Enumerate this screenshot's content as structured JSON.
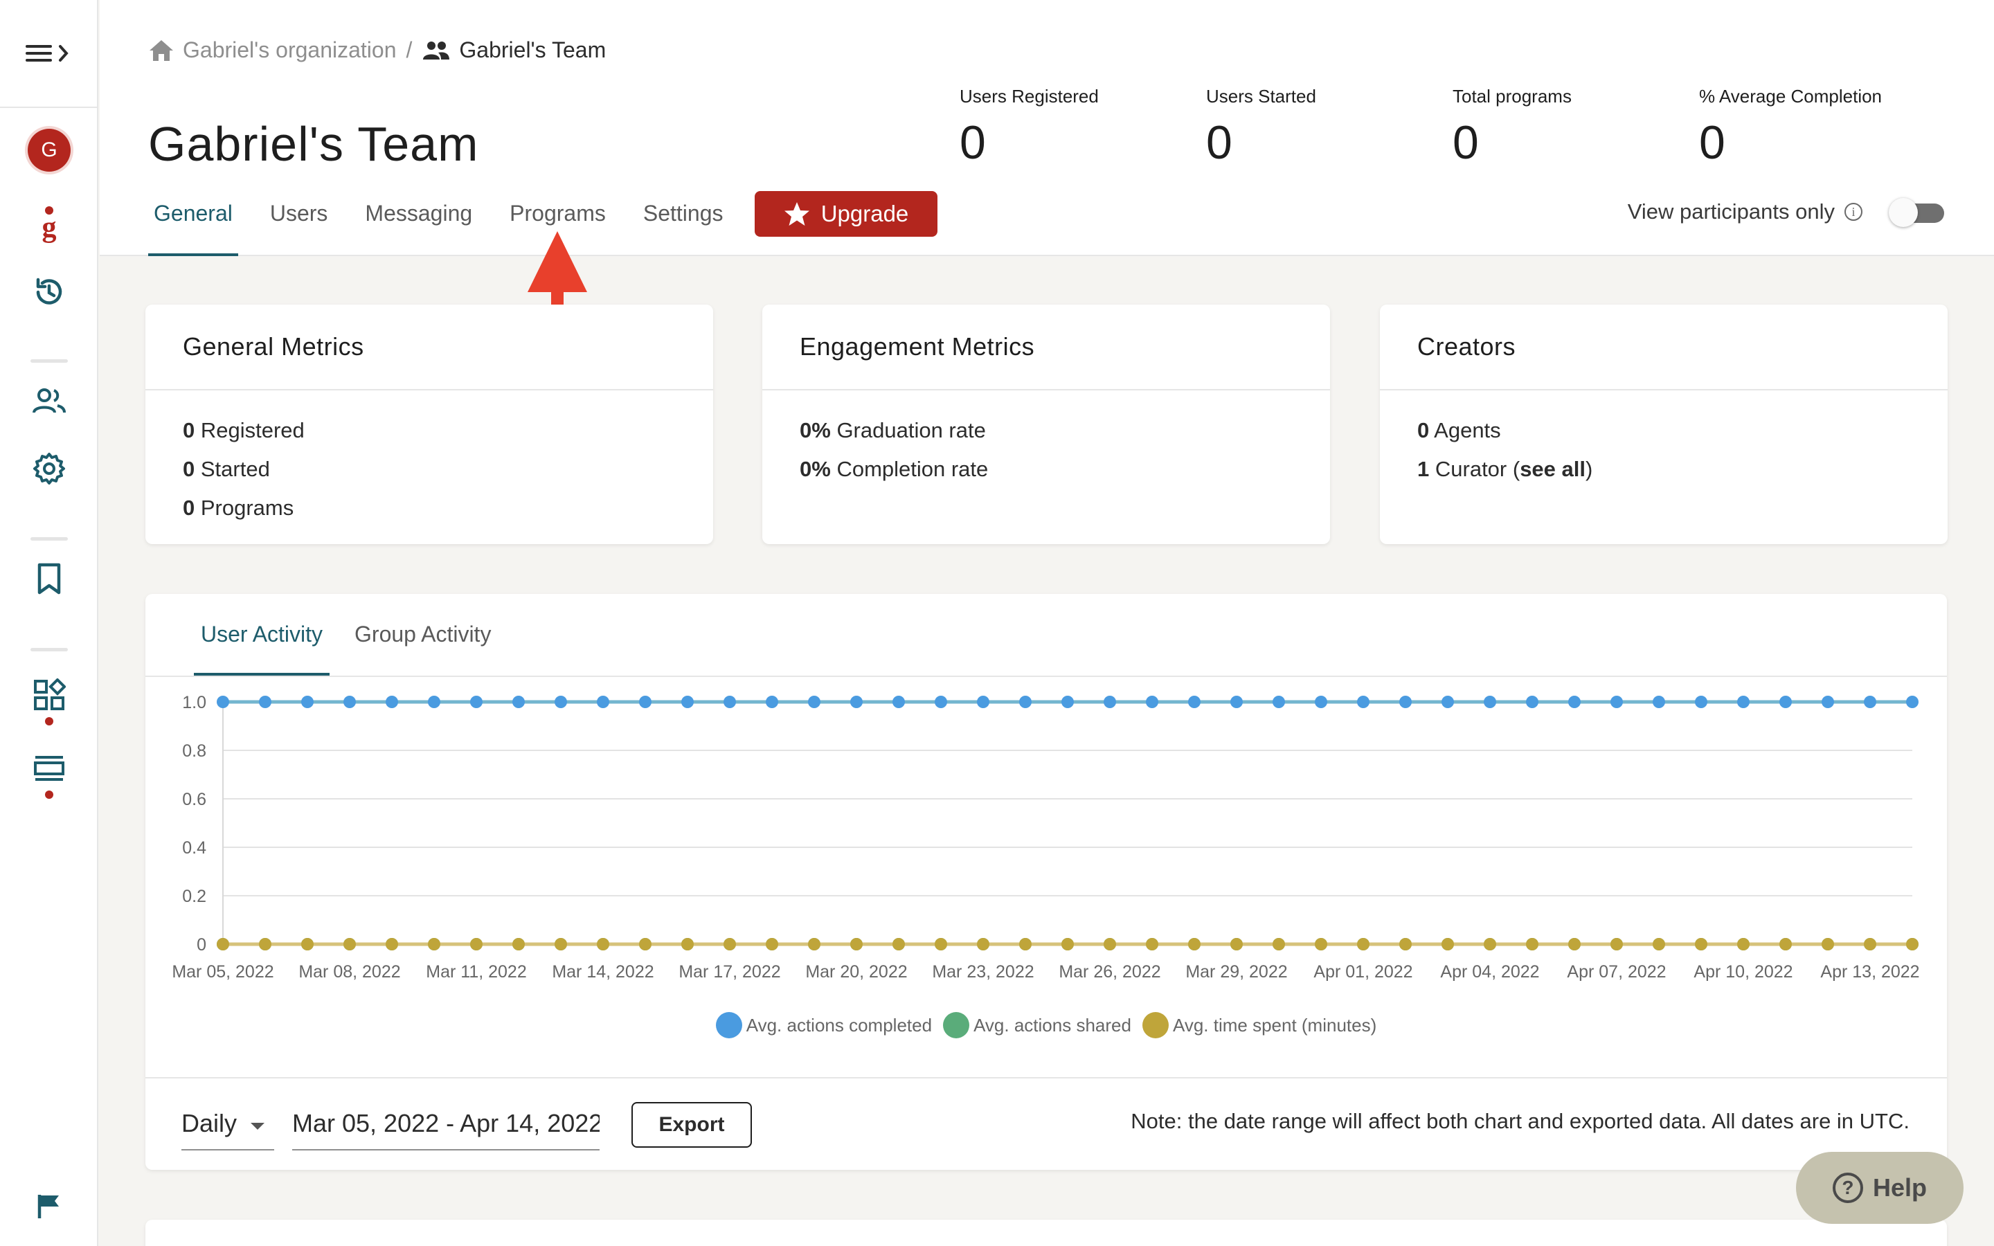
{
  "breadcrumb": {
    "org": "Gabriel's organization",
    "separator": "/",
    "team": "Gabriel's Team"
  },
  "page_title": "Gabriel's Team",
  "stats": [
    {
      "label": "Users Registered",
      "value": "0"
    },
    {
      "label": "Users Started",
      "value": "0"
    },
    {
      "label": "Total programs",
      "value": "0"
    },
    {
      "label": "% Average Completion",
      "value": "0"
    }
  ],
  "tabs": [
    {
      "label": "General",
      "active": true
    },
    {
      "label": "Users"
    },
    {
      "label": "Messaging"
    },
    {
      "label": "Programs"
    },
    {
      "label": "Settings"
    }
  ],
  "upgrade_label": "Upgrade",
  "view_participants_label": "View participants only",
  "avatar_initial": "G",
  "cards": {
    "general": {
      "title": "General Metrics",
      "rows": [
        {
          "value": "0",
          "label": "Registered"
        },
        {
          "value": "0",
          "label": "Started"
        },
        {
          "value": "0",
          "label": "Programs"
        }
      ]
    },
    "engagement": {
      "title": "Engagement Metrics",
      "rows": [
        {
          "value": "0%",
          "label": "Graduation rate"
        },
        {
          "value": "0%",
          "label": "Completion rate"
        }
      ]
    },
    "creators": {
      "title": "Creators",
      "rows": [
        {
          "value": "0",
          "label": "Agents"
        },
        {
          "value": "1",
          "label": "Curator (",
          "link": "see all",
          "suffix": ")"
        }
      ]
    }
  },
  "activity_tabs": [
    {
      "label": "User Activity",
      "active": true
    },
    {
      "label": "Group Activity"
    }
  ],
  "chart_data": {
    "type": "line",
    "x": [
      "Mar 05, 2022",
      "Mar 06, 2022",
      "Mar 07, 2022",
      "Mar 08, 2022",
      "Mar 09, 2022",
      "Mar 10, 2022",
      "Mar 11, 2022",
      "Mar 12, 2022",
      "Mar 13, 2022",
      "Mar 14, 2022",
      "Mar 15, 2022",
      "Mar 16, 2022",
      "Mar 17, 2022",
      "Mar 18, 2022",
      "Mar 19, 2022",
      "Mar 20, 2022",
      "Mar 21, 2022",
      "Mar 22, 2022",
      "Mar 23, 2022",
      "Mar 24, 2022",
      "Mar 25, 2022",
      "Mar 26, 2022",
      "Mar 27, 2022",
      "Mar 28, 2022",
      "Mar 29, 2022",
      "Mar 30, 2022",
      "Mar 31, 2022",
      "Apr 01, 2022",
      "Apr 02, 2022",
      "Apr 03, 2022",
      "Apr 04, 2022",
      "Apr 05, 2022",
      "Apr 06, 2022",
      "Apr 07, 2022",
      "Apr 08, 2022",
      "Apr 09, 2022",
      "Apr 10, 2022",
      "Apr 11, 2022",
      "Apr 12, 2022",
      "Apr 13, 2022",
      "Apr 14, 2022"
    ],
    "x_tick_labels": [
      "Mar 05, 2022",
      "Mar 08, 2022",
      "Mar 11, 2022",
      "Mar 14, 2022",
      "Mar 17, 2022",
      "Mar 20, 2022",
      "Mar 23, 2022",
      "Mar 26, 2022",
      "Mar 29, 2022",
      "Apr 01, 2022",
      "Apr 04, 2022",
      "Apr 07, 2022",
      "Apr 10, 2022",
      "Apr 13, 2022"
    ],
    "y_ticks": [
      "0",
      "0.2",
      "0.4",
      "0.6",
      "0.8",
      "1.0"
    ],
    "ylim": [
      0,
      1
    ],
    "grid": true,
    "legend_position": "bottom",
    "series": [
      {
        "name": "Avg. actions completed",
        "color": "#4a9be0",
        "line_color": "#74b6cf",
        "values": [
          1,
          1,
          1,
          1,
          1,
          1,
          1,
          1,
          1,
          1,
          1,
          1,
          1,
          1,
          1,
          1,
          1,
          1,
          1,
          1,
          1,
          1,
          1,
          1,
          1,
          1,
          1,
          1,
          1,
          1,
          1,
          1,
          1,
          1,
          1,
          1,
          1,
          1,
          1,
          1,
          1
        ]
      },
      {
        "name": "Avg. actions shared",
        "color": "#5aac7a",
        "values": [
          0,
          0,
          0,
          0,
          0,
          0,
          0,
          0,
          0,
          0,
          0,
          0,
          0,
          0,
          0,
          0,
          0,
          0,
          0,
          0,
          0,
          0,
          0,
          0,
          0,
          0,
          0,
          0,
          0,
          0,
          0,
          0,
          0,
          0,
          0,
          0,
          0,
          0,
          0,
          0,
          0
        ]
      },
      {
        "name": "Avg. time spent (minutes)",
        "color": "#bfa53a",
        "line_color": "#d6c27a",
        "values": [
          0,
          0,
          0,
          0,
          0,
          0,
          0,
          0,
          0,
          0,
          0,
          0,
          0,
          0,
          0,
          0,
          0,
          0,
          0,
          0,
          0,
          0,
          0,
          0,
          0,
          0,
          0,
          0,
          0,
          0,
          0,
          0,
          0,
          0,
          0,
          0,
          0,
          0,
          0,
          0,
          0
        ]
      }
    ]
  },
  "controls": {
    "period": "Daily",
    "date_range": "Mar 05, 2022 - Apr 14, 2022",
    "export_label": "Export",
    "note": "Note: the date range will affect both chart and exported data. All dates are in UTC."
  },
  "help_label": "Help",
  "colors": {
    "brand_red": "#b3261e",
    "accent_teal": "#1d5c6b",
    "annotation_arrow": "#e8402c"
  }
}
